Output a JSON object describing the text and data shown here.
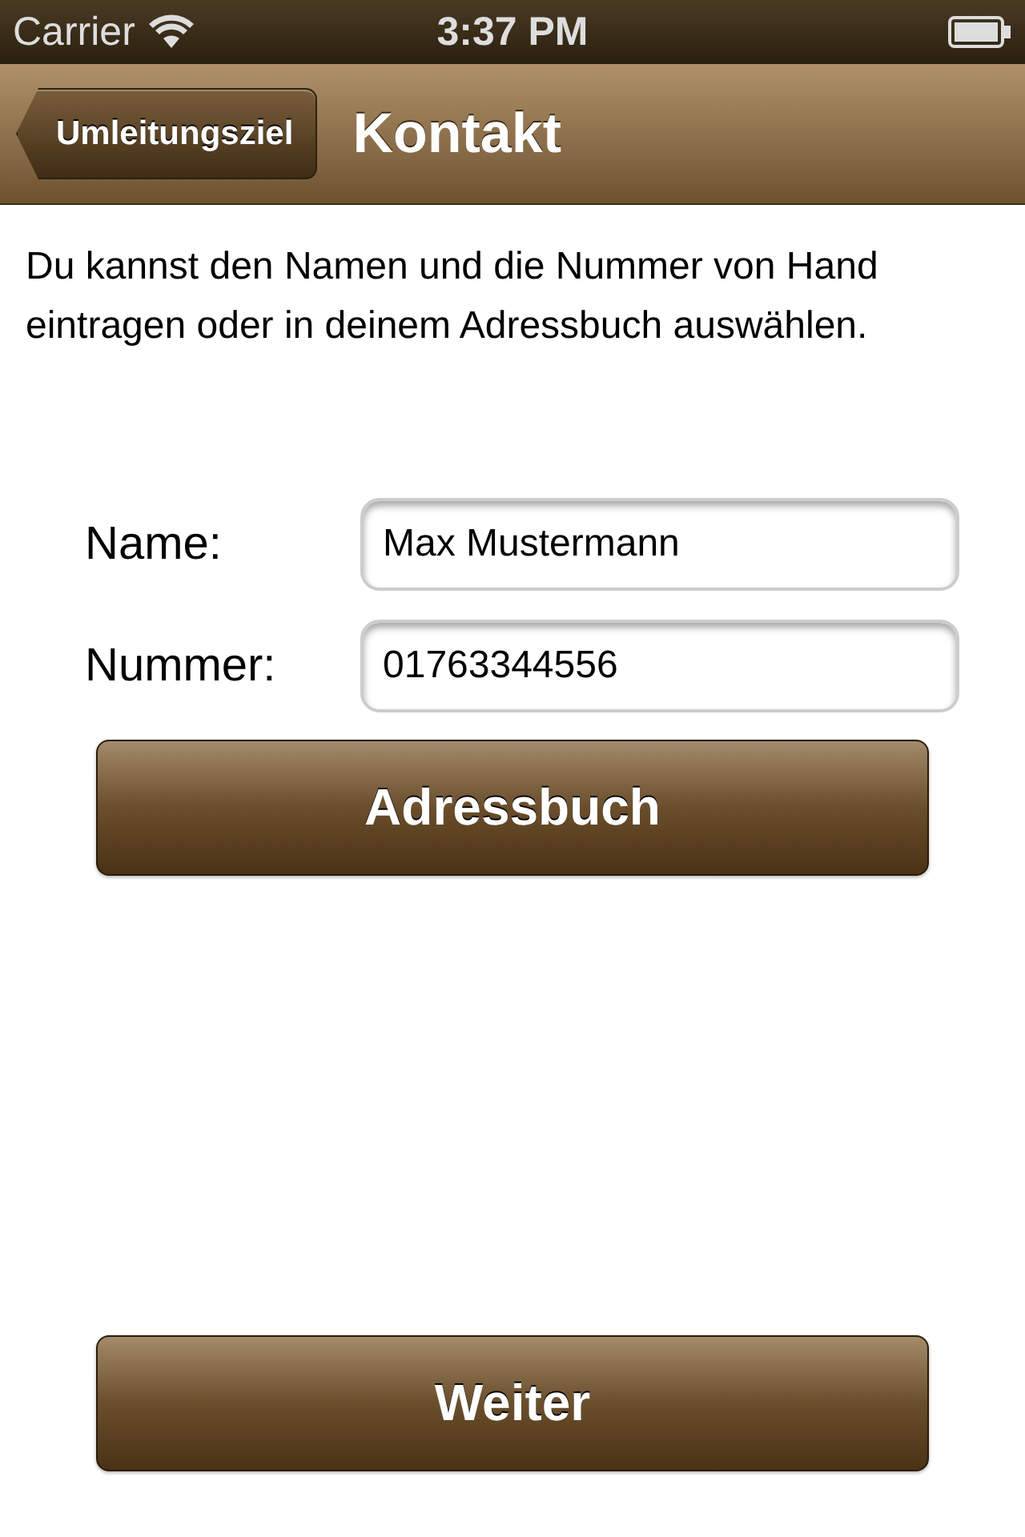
{
  "status_bar": {
    "carrier": "Carrier",
    "time": "3:37 PM"
  },
  "nav_bar": {
    "back_button": "Umleitungsziel",
    "title": "Kontakt"
  },
  "intro": "Du kannst den Namen und die Nummer von Hand eintragen oder in deinem Adressbuch auswählen.",
  "fields": [
    {
      "label": "Name:",
      "value": "Max Mustermann"
    },
    {
      "label": "Nummer:",
      "value": "01763344556"
    }
  ],
  "address_book_button": "Adressbuch",
  "next_button": "Weiter"
}
